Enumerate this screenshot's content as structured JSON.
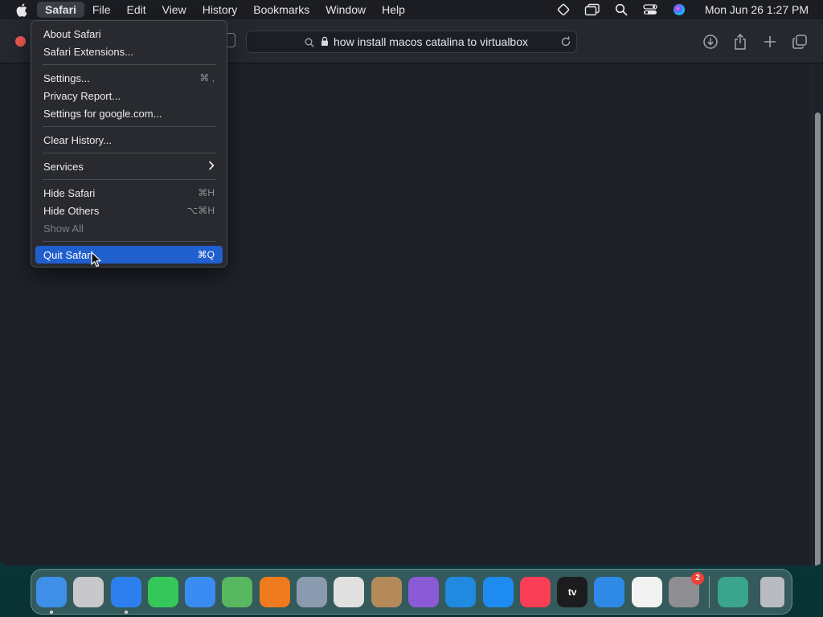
{
  "menubar": {
    "items": [
      {
        "label": "Safari",
        "active": true
      },
      {
        "label": "File"
      },
      {
        "label": "Edit"
      },
      {
        "label": "View"
      },
      {
        "label": "History"
      },
      {
        "label": "Bookmarks"
      },
      {
        "label": "Window"
      },
      {
        "label": "Help"
      }
    ],
    "status_icons": [
      "vpn-diamond-icon",
      "screen-mirroring-icon",
      "spotlight-search-icon",
      "control-center-icon",
      "siri-icon"
    ],
    "clock": "Mon Jun 26  1:27 PM"
  },
  "toolbar": {
    "url": "how install macos catalina to virtualbox"
  },
  "safari_menu": {
    "groups": [
      [
        {
          "label": "About Safari",
          "shortcut": ""
        },
        {
          "label": "Safari Extensions...",
          "shortcut": ""
        }
      ],
      [
        {
          "label": "Settings...",
          "shortcut": "⌘ ,"
        },
        {
          "label": "Privacy Report...",
          "shortcut": ""
        },
        {
          "label": "Settings for google.com...",
          "shortcut": ""
        }
      ],
      [
        {
          "label": "Clear History...",
          "shortcut": ""
        }
      ],
      [
        {
          "label": "Services",
          "shortcut": "",
          "submenu": true
        }
      ],
      [
        {
          "label": "Hide Safari",
          "shortcut": "⌘H"
        },
        {
          "label": "Hide Others",
          "shortcut": "⌥⌘H"
        },
        {
          "label": "Show All",
          "shortcut": "",
          "disabled": true
        }
      ],
      [
        {
          "label": "Quit Safari",
          "shortcut": "⌘Q",
          "highlight": true
        }
      ]
    ]
  },
  "dock": {
    "apps": [
      {
        "name": "finder",
        "color": "#3d8fe8",
        "running": true
      },
      {
        "name": "launchpad",
        "color": "#c8c8cc"
      },
      {
        "name": "safari",
        "color": "#2d7ff0",
        "running": true
      },
      {
        "name": "messages",
        "color": "#35c759"
      },
      {
        "name": "mail",
        "color": "#3a8cf2"
      },
      {
        "name": "maps",
        "color": "#58b861"
      },
      {
        "name": "firefox",
        "color": "#f07a1e"
      },
      {
        "name": "disk-utility",
        "color": "#8a9bb0"
      },
      {
        "name": "chrome",
        "color": "#e0e0e0"
      },
      {
        "name": "contacts",
        "color": "#b48a5a"
      },
      {
        "name": "visual-studio",
        "color": "#8b5ad6"
      },
      {
        "name": "vscode",
        "color": "#1f8ae0"
      },
      {
        "name": "app-store",
        "color": "#1d8bf1"
      },
      {
        "name": "music",
        "color": "#fa3e55"
      },
      {
        "name": "apple-tv",
        "color": "#1c1c1e",
        "label": "tv"
      },
      {
        "name": "keynote",
        "color": "#2e8ae6"
      },
      {
        "name": "news",
        "color": "#f2f2f2"
      },
      {
        "name": "system-settings",
        "color": "#8e8e93",
        "badge": "2"
      },
      {
        "name": "sparkle-app",
        "color": "#3aa58a"
      },
      {
        "name": "trash",
        "color": "#b8bcc0"
      }
    ]
  }
}
